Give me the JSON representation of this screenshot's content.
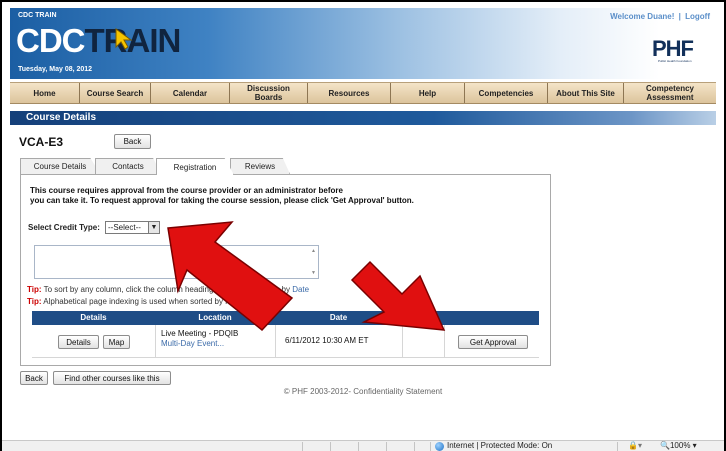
{
  "header": {
    "site_name": "CDC TRAIN",
    "logo_cdc": "CDC",
    "logo_train": "TRAIN",
    "date": "Tuesday, May 08, 2012",
    "welcome": "Welcome Duane!",
    "logoff": "Logoff",
    "separator": "|",
    "phf_logo": "PHF",
    "phf_sub": "Public Health Foundation"
  },
  "nav": {
    "items": [
      {
        "label": "Home"
      },
      {
        "label": "Course Search"
      },
      {
        "label": "Calendar"
      },
      {
        "label": "Discussion Boards"
      },
      {
        "label": "Resources"
      },
      {
        "label": "Help"
      },
      {
        "label": "Competencies"
      },
      {
        "label": "About This Site"
      },
      {
        "label": "Competency Assessment"
      }
    ]
  },
  "section_title": "Course Details",
  "course_code": "VCA-E3",
  "back_label": "Back",
  "tabs": [
    {
      "label": "Course Details"
    },
    {
      "label": "Contacts"
    },
    {
      "label": "Registration"
    },
    {
      "label": "Reviews"
    }
  ],
  "registration": {
    "message_line1": "This course requires approval from the course provider or an administrator before",
    "message_line2": "you can take it. To request approval for taking the course session, please click 'Get Approval' button.",
    "credit_label": "Select Credit Type:",
    "credit_selected": "--Select--",
    "tip_key": "Tip:",
    "tip1_text": "To sort by any column, click the column heading. Use default order by",
    "tip1_link": "Date",
    "tip2_text": "Alphabetical page indexing is used when sorted by location."
  },
  "grid": {
    "headers": [
      "Details",
      "Location",
      "Date"
    ],
    "row": {
      "details_label": "Details",
      "map_label": "Map",
      "location": "Live Meeting - PDQIB",
      "location_sub": "Multi-Day Event...",
      "date": "6/11/2012 10:30 AM ET",
      "approval_label": "Get Approval"
    }
  },
  "bottom": {
    "back_label": "Back",
    "find_label": "Find other courses like this"
  },
  "footer": "© PHF 2003-2012- Confidentiality Statement",
  "statusbar": {
    "zone": "Internet | Protected Mode: On",
    "zoom": "100%"
  },
  "colors": {
    "header_blue": "#1b5ea3",
    "nav_tan": "#dcc49c",
    "section_blue": "#15407a",
    "grid_head": "#1f4d86",
    "annotation_red": "#e01010"
  }
}
